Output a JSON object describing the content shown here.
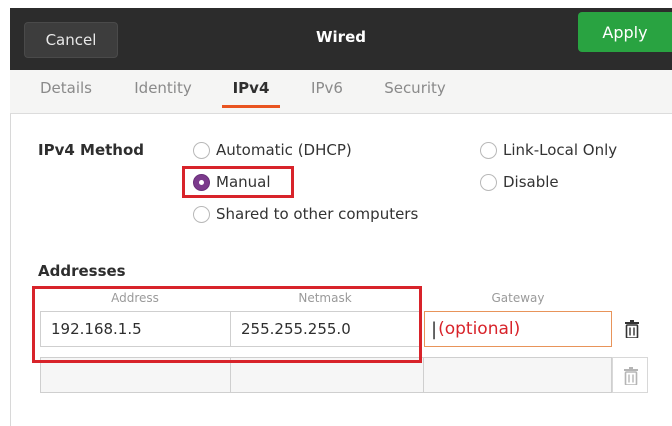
{
  "header": {
    "cancel_label": "Cancel",
    "title": "Wired",
    "apply_label": "Apply"
  },
  "tabs": [
    {
      "label": "Details",
      "active": false
    },
    {
      "label": "Identity",
      "active": false
    },
    {
      "label": "IPv4",
      "active": true
    },
    {
      "label": "IPv6",
      "active": false
    },
    {
      "label": "Security",
      "active": false
    }
  ],
  "ipv4": {
    "method_label": "IPv4 Method",
    "methods": {
      "automatic": "Automatic (DHCP)",
      "manual": "Manual",
      "shared": "Shared to other computers",
      "link_local": "Link-Local Only",
      "disable": "Disable"
    },
    "selected_method": "Manual"
  },
  "addresses": {
    "label": "Addresses",
    "columns": {
      "address": "Address",
      "netmask": "Netmask",
      "gateway": "Gateway"
    },
    "rows": [
      {
        "address": "192.168.1.5",
        "netmask": "255.255.255.0",
        "gateway": "(optional)"
      },
      {
        "address": "",
        "netmask": "",
        "gateway": ""
      }
    ]
  },
  "colors": {
    "accent": "#e95420",
    "apply_green": "#29a341",
    "radio_checked": "#7b3a8c",
    "highlight_red": "#d8232a"
  },
  "icons": {
    "delete": "trash-icon"
  }
}
